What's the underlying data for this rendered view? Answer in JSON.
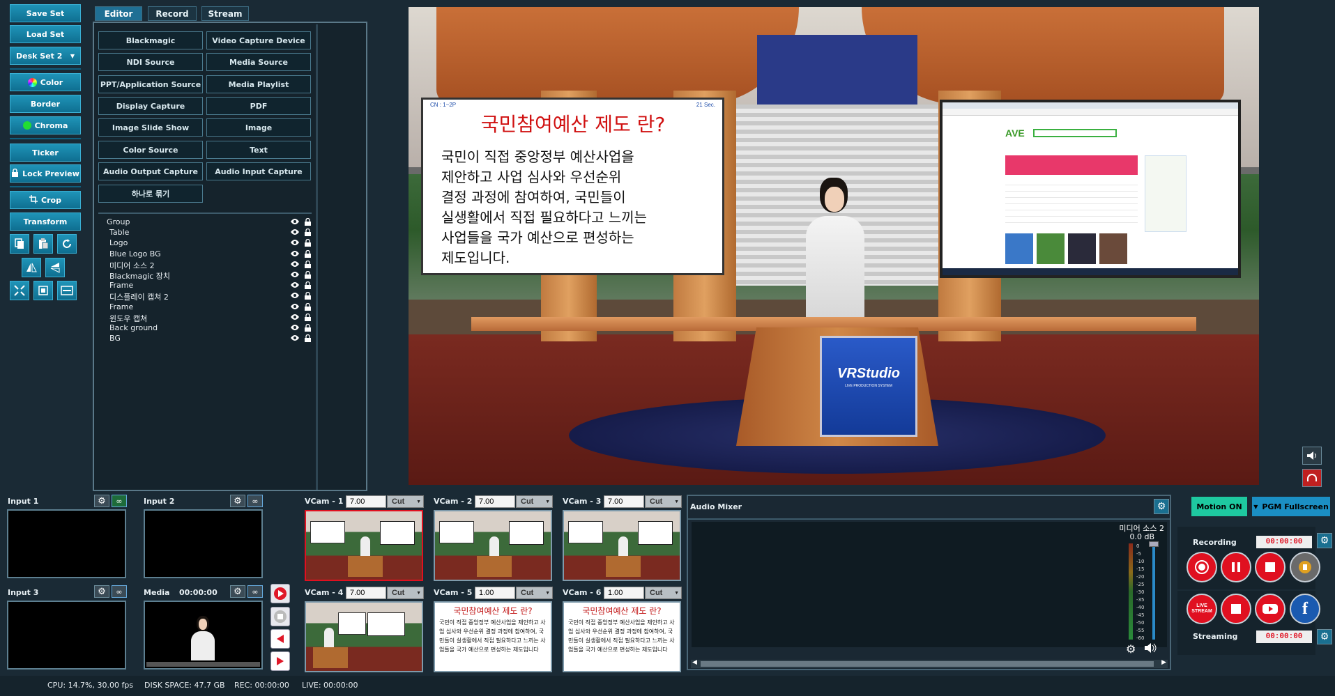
{
  "toolbar": {
    "save_set": "Save Set",
    "load_set": "Load Set",
    "desk_set": "Desk Set 2",
    "color": "Color",
    "border": "Border",
    "chroma": "Chroma",
    "ticker": "Ticker",
    "lock_preview": "Lock Preview",
    "crop": "Crop",
    "transform": "Transform"
  },
  "tabs": {
    "editor": "Editor",
    "record": "Record",
    "stream": "Stream"
  },
  "sources": {
    "blackmagic": "Blackmagic",
    "video_capture": "Video Capture Device",
    "ndi": "NDI Source",
    "media_source": "Media Source",
    "ppt": "PPT/Application Source",
    "media_playlist": "Media Playlist",
    "display_capture": "Display Capture",
    "pdf": "PDF",
    "image_slide": "Image Slide Show",
    "image": "Image",
    "color_source": "Color Source",
    "text": "Text",
    "audio_output": "Audio Output Capture",
    "audio_input": "Audio Input Capture",
    "group_one": "하나로 묶기"
  },
  "layers": [
    "Group",
    "Table",
    "Logo",
    "Blue Logo BG",
    "미디어 소스 2",
    "Blackmagic 장치",
    "Frame",
    "디스플레이 캡쳐 2",
    "Frame",
    "윈도우 캡쳐",
    "Back ground",
    "BG"
  ],
  "preview": {
    "caption_small_left": "CN : 1~2P",
    "caption_small_right": "21 Sec.",
    "caption_title": "국민참여예산 제도 란?",
    "caption_lines": [
      "국민이 직접 중앙정부 예산사업을",
      "제안하고 사업 심사와 우선순위",
      "결정 과정에 참여하여, 국민들이",
      "실생활에서 직접 필요하다고 느끼는",
      "사업들을 국가 예산으로 편성하는",
      "제도입니다."
    ],
    "logo_text": "VRStudio",
    "logo_sub": "LIVE PRODUCTION SYSTEM",
    "browser_brand": "AVE"
  },
  "inputs": {
    "input1": "Input 1",
    "input2": "Input 2",
    "input3": "Input 3",
    "media": "Media",
    "media_time": "00:00:00"
  },
  "vcams": [
    {
      "label": "VCam - 1",
      "value": "7.00",
      "mode": "Cut"
    },
    {
      "label": "VCam - 2",
      "value": "7.00",
      "mode": "Cut"
    },
    {
      "label": "VCam - 3",
      "value": "7.00",
      "mode": "Cut"
    },
    {
      "label": "VCam - 4",
      "value": "7.00",
      "mode": "Cut"
    },
    {
      "label": "VCam - 5",
      "value": "1.00",
      "mode": "Cut"
    },
    {
      "label": "VCam - 6",
      "value": "1.00",
      "mode": "Cut"
    }
  ],
  "vcam_mini_caption": {
    "title": "국민참여예산 제도 란?",
    "text": "국민이 직접 중앙정부 예산사업을 제안하고 사업 심사와 우선순위 결정 과정에 참여하여, 국민들이 실생활에서 직접 필요하다고 느끼는 사업들을 국가 예산으로 편성하는 제도입니다"
  },
  "audio": {
    "title": "Audio Mixer",
    "channel_name": "미디어 소스 2",
    "db": "0.0 dB",
    "scale": [
      "0",
      "-5",
      "-10",
      "-15",
      "-20",
      "-25",
      "-30",
      "-35",
      "-40",
      "-45",
      "-50",
      "-55",
      "-60"
    ]
  },
  "right": {
    "motion_on": "Motion ON",
    "pgm_fullscreen": "PGM Fullscreen",
    "recording": "Recording",
    "recording_time": "00:00:00",
    "streaming": "Streaming",
    "streaming_time": "00:00:00",
    "live_stream": "LIVE STREAM"
  },
  "status": {
    "cpu": "CPU: 14.7%, 30.00 fps",
    "disk": "DISK SPACE: 47.7 GB",
    "rec": "REC: 00:00:00",
    "live": "LIVE: 00:00:00"
  },
  "colors": {
    "bg": "#1a2a35",
    "button_blue": "#1b86ad",
    "motion_green": "#1ec9a0",
    "pgm_blue": "#1b8fc4",
    "record_red": "#e01020",
    "caption_red": "#d01010"
  }
}
